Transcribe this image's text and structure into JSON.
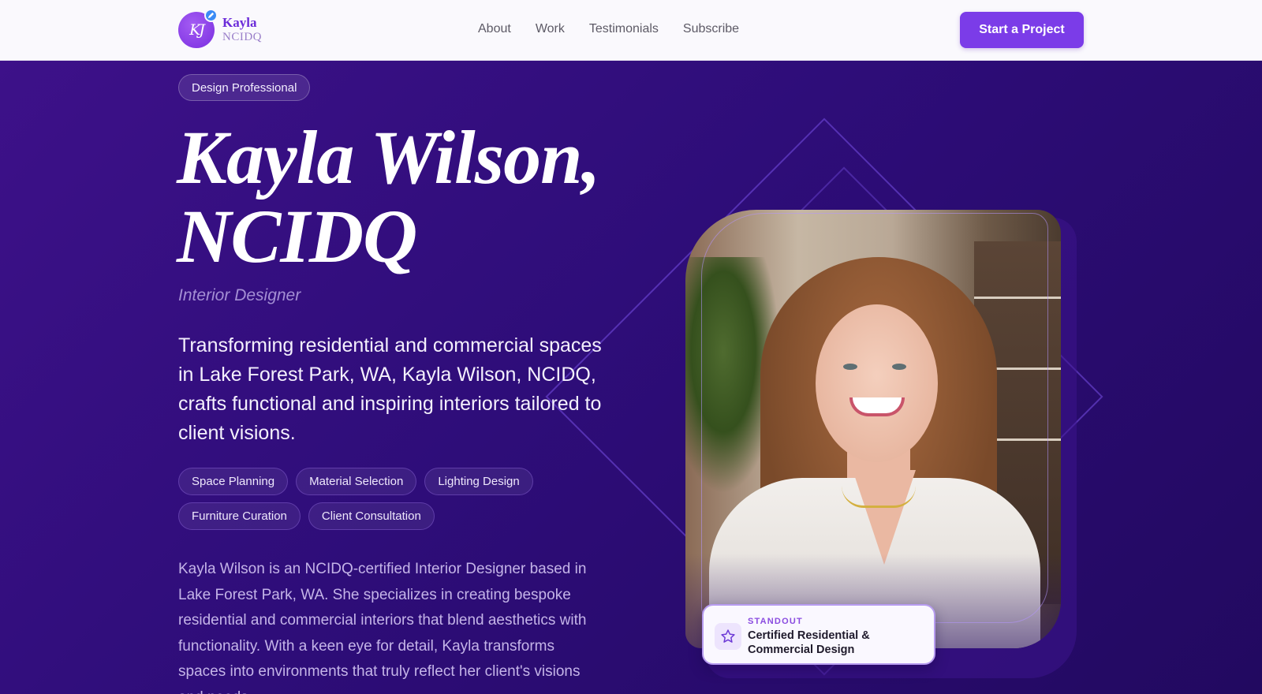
{
  "brand": {
    "monogram": "KJ",
    "line1": "Kayla",
    "line2": "NCIDQ"
  },
  "nav": {
    "items": [
      "About",
      "Work",
      "Testimonials",
      "Subscribe"
    ]
  },
  "cta": {
    "label": "Start a Project"
  },
  "hero": {
    "badge": "Design Professional",
    "name_line1": "Kayla Wilson,",
    "name_line2": "NCIDQ",
    "role": "Interior Designer",
    "lead": "Transforming residential and commercial spaces in Lake Forest Park, WA, Kayla Wilson, NCIDQ, crafts functional and inspiring interiors tailored to client visions.",
    "tags": [
      "Space Planning",
      "Material Selection",
      "Lighting Design",
      "Furniture Curation",
      "Client Consultation"
    ],
    "bio": "Kayla Wilson is an NCIDQ-certified Interior Designer based in Lake Forest Park, WA. She specializes in creating bespoke residential and commercial interiors that blend aesthetics with functionality. With a keen eye for detail, Kayla transforms spaces into environments that truly reflect her client's visions and needs."
  },
  "standout": {
    "kicker": "STANDOUT",
    "title": "Certified Residential & Commercial Design",
    "icon": "star-icon"
  },
  "colors": {
    "accent": "#7b3ce8",
    "hero_bg": "#2e0d79",
    "header_bg": "#faf9fd"
  }
}
